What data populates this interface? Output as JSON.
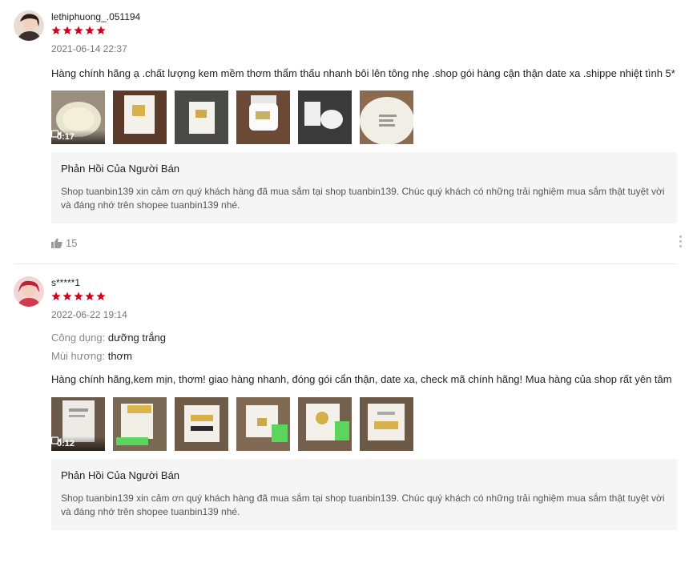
{
  "reviews": [
    {
      "username": "lethiphuong_.051194",
      "rating": 5,
      "date": "2021-06-14 22:37",
      "attributes": [],
      "text": "Hàng chính hãng ạ .chất lượng kem mềm thơm thẩm thấu nhanh bôi lên tông nhẹ .shop gói hàng cận thận date xa .shippe nhiệt tình 5*",
      "video_duration": "0:17",
      "reply_title": "Phản Hồi Của Người Bán",
      "reply_text": "Shop tuanbin139 xin cảm ơn quý khách hàng đã mua sắm tại shop tuanbin139. Chúc quý khách có những trải nghiệm mua sắm thật tuyệt vời và đáng nhớ trên shopee tuanbin139 nhé.",
      "likes": "15"
    },
    {
      "username": "s*****1",
      "rating": 5,
      "date": "2022-06-22 19:14",
      "attributes": [
        {
          "key": "Công dụng:",
          "value": "dưỡng trắng"
        },
        {
          "key": "Mùi hương:",
          "value": "thơm"
        }
      ],
      "text": "Hàng chính hãng,kem mịn, thơm! giao hàng nhanh, đóng gói cẩn thận, date xa, check mã chính hãng! Mua hàng của shop rất yên tâm",
      "video_duration": "0:12",
      "reply_title": "Phản Hồi Của Người Bán",
      "reply_text": "Shop tuanbin139 xin cảm ơn quý khách hàng đã mua sắm tại shop tuanbin139. Chúc quý khách có những trải nghiệm mua sắm thật tuyệt vời và đáng nhớ trên shopee tuanbin139 nhé."
    }
  ],
  "colors": {
    "star": "#d0011b",
    "reply_bg": "#f5f5f5"
  }
}
